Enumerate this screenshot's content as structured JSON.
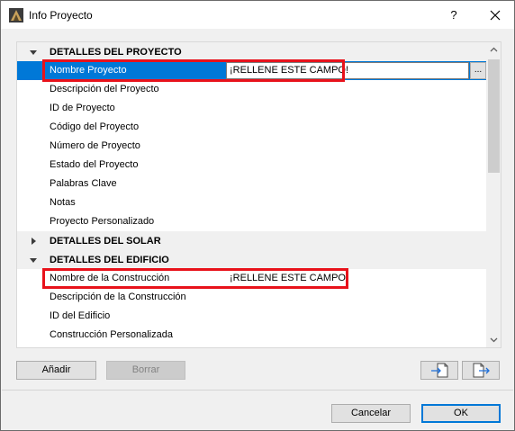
{
  "window": {
    "title": "Info Proyecto",
    "help_label": "?",
    "close_icon": "close-icon"
  },
  "colors": {
    "selection": "#0078d7",
    "highlight_box": "#e8121b",
    "section_header_bg": "#f0f0f0"
  },
  "sections": [
    {
      "title": "DETALLES DEL PROYECTO",
      "expanded": true,
      "fields": [
        {
          "label": "Nombre Proyecto",
          "value": "¡RELLENE ESTE CAMPO!",
          "selected": true,
          "more_label": "..."
        },
        {
          "label": "Descripción del Proyecto",
          "value": ""
        },
        {
          "label": "ID de Proyecto",
          "value": ""
        },
        {
          "label": "Código del Proyecto",
          "value": ""
        },
        {
          "label": "Número de Proyecto",
          "value": ""
        },
        {
          "label": "Estado del Proyecto",
          "value": ""
        },
        {
          "label": "Palabras Clave",
          "value": ""
        },
        {
          "label": "Notas",
          "value": ""
        },
        {
          "label": "Proyecto Personalizado",
          "value": ""
        }
      ]
    },
    {
      "title": "DETALLES DEL SOLAR",
      "expanded": false,
      "fields": []
    },
    {
      "title": "DETALLES DEL EDIFICIO",
      "expanded": true,
      "fields": [
        {
          "label": "Nombre de la Construcción",
          "value": "¡RELLENE ESTE CAMPO!"
        },
        {
          "label": "Descripción de la Construcción",
          "value": ""
        },
        {
          "label": "ID del Edificio",
          "value": ""
        },
        {
          "label": "Construcción Personalizada",
          "value": ""
        }
      ]
    }
  ],
  "buttons": {
    "add": "Añadir",
    "delete": "Borrar",
    "import_icon": "import-file-icon",
    "export_icon": "export-file-icon",
    "cancel": "Cancelar",
    "ok": "OK"
  }
}
